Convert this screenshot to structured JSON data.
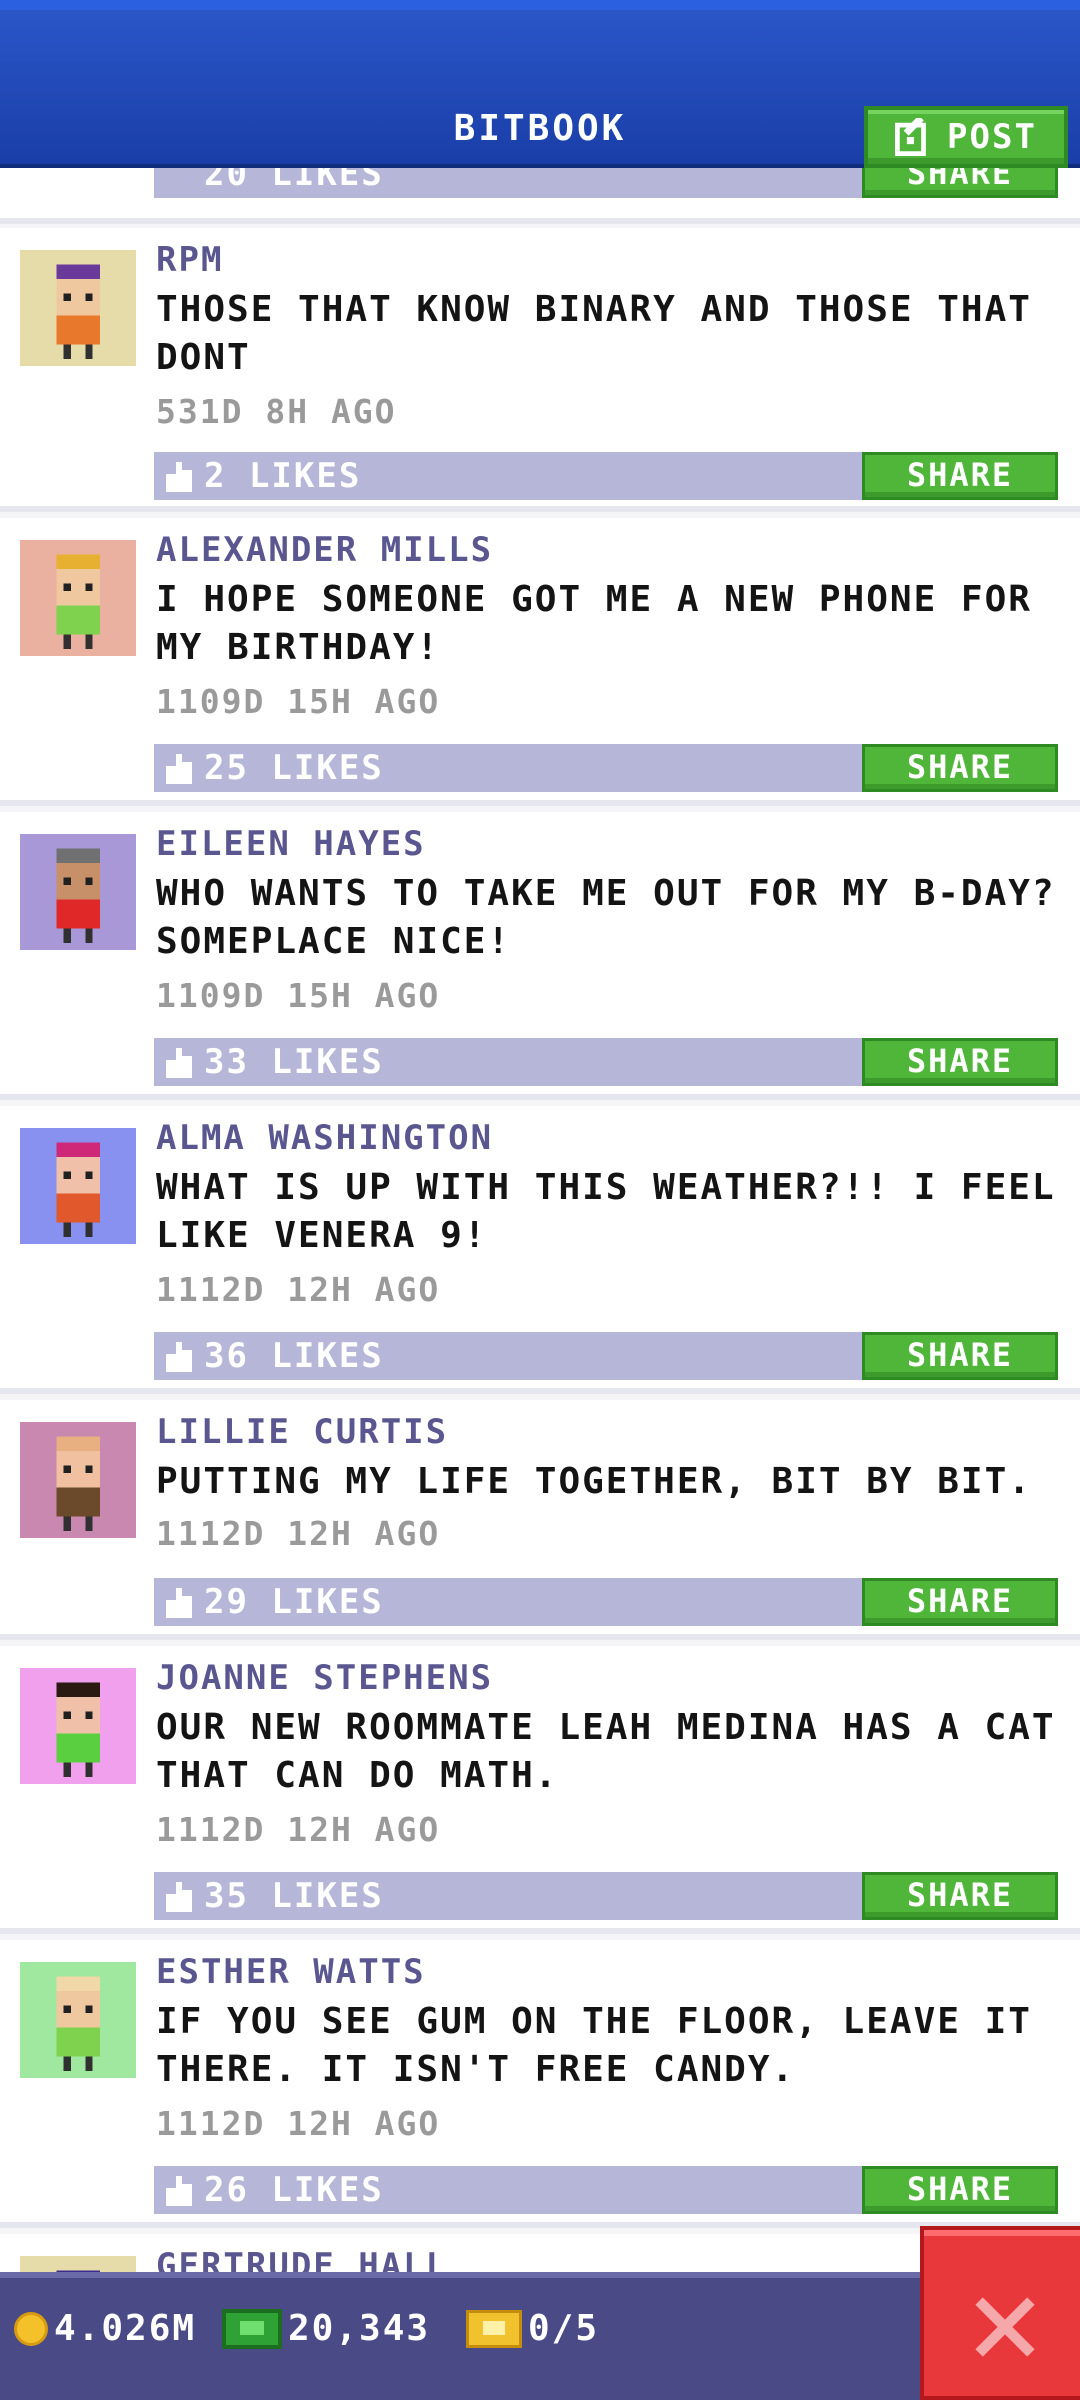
{
  "header": {
    "title": "BITBOOK",
    "post_label": "POST"
  },
  "partial_top": {
    "likes": "20 LIKES",
    "share": "SHARE"
  },
  "posts": [
    {
      "author": "RPM",
      "message": "THOSE THAT KNOW BINARY AND THOSE THAT DONT",
      "time": "531D 8H AGO",
      "likes": "2 LIKES",
      "share": "SHARE",
      "avatar_bg": "#e6dcaa",
      "shirt": "#e8792c",
      "skin": "#f0c8a0",
      "hair": "#6a3a9a"
    },
    {
      "author": "ALEXANDER MILLS",
      "message": "I HOPE SOMEONE GOT ME A NEW PHONE FOR MY BIRTHDAY!",
      "time": "1109D 15H AGO",
      "likes": "25 LIKES",
      "share": "SHARE",
      "avatar_bg": "#eab0a0",
      "shirt": "#7ed24e",
      "skin": "#f0c8a0",
      "hair": "#e8b030"
    },
    {
      "author": "EILEEN HAYES",
      "message": "WHO WANTS TO TAKE ME OUT FOR MY B-DAY? SOMEPLACE NICE!",
      "time": "1109D 15H AGO",
      "likes": "33 LIKES",
      "share": "SHARE",
      "avatar_bg": "#a898d8",
      "shirt": "#e02828",
      "skin": "#c89068",
      "hair": "#707070"
    },
    {
      "author": "ALMA WASHINGTON",
      "message": "WHAT IS UP WITH THIS WEATHER?!! I FEEL LIKE VENERA 9!",
      "time": "1112D 12H AGO",
      "likes": "36 LIKES",
      "share": "SHARE",
      "avatar_bg": "#8890f0",
      "shirt": "#e0582c",
      "skin": "#f0c0a8",
      "hair": "#d02878"
    },
    {
      "author": "LILLIE CURTIS",
      "message": "PUTTING MY LIFE TOGETHER, BIT BY BIT.",
      "time": "1112D 12H AGO",
      "likes": "29 LIKES",
      "share": "SHARE",
      "avatar_bg": "#c888b0",
      "shirt": "#6a4a2a",
      "skin": "#f0c0a0",
      "hair": "#e8b080"
    },
    {
      "author": "JOANNE STEPHENS",
      "message": "OUR NEW ROOMMATE LEAH MEDINA HAS A CAT THAT CAN DO MATH.",
      "time": "1112D 12H AGO",
      "likes": "35 LIKES",
      "share": "SHARE",
      "avatar_bg": "#f0a0ec",
      "shirt": "#5ad040",
      "skin": "#f0c0a8",
      "hair": "#2a1a12"
    },
    {
      "author": "ESTHER WATTS",
      "message": "IF YOU SEE GUM ON THE FLOOR, LEAVE IT THERE. IT ISN'T FREE CANDY.",
      "time": "1112D 12H AGO",
      "likes": "26 LIKES",
      "share": "SHARE",
      "avatar_bg": "#a0e8a0",
      "shirt": "#7ed24e",
      "skin": "#f0c8a0",
      "hair": "#f0d8a8"
    },
    {
      "author": "GERTRUDE HALL",
      "avatar_bg": "#e6dcaa",
      "shirt": "#3a2a90",
      "skin": "#f0c8a0",
      "hair": "#3a2a90"
    }
  ],
  "bottom_bar": {
    "coins": "4.026M",
    "bux": "20,343",
    "tickets": "0/5"
  },
  "icons": {
    "post": "edit-icon",
    "like": "thumbs-up-icon",
    "close": "close-icon",
    "coin": "coin-icon",
    "bux": "bux-icon",
    "ticket": "ticket-icon"
  }
}
